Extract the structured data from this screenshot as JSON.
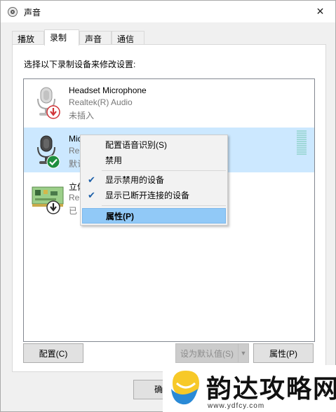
{
  "window": {
    "title": "声音",
    "close_symbol": "✕"
  },
  "tabs": [
    {
      "label": "播放"
    },
    {
      "label": "录制"
    },
    {
      "label": "声音"
    },
    {
      "label": "通信"
    }
  ],
  "panel": {
    "instruction": "选择以下录制设备来修改设置:"
  },
  "devices": [
    {
      "name": "Headset Microphone",
      "subtitle": "Realtek(R) Audio",
      "status": "未插入",
      "icon": "headset-microphone-icon",
      "badge": "red-down-arrow-badge"
    },
    {
      "name": "Microphone",
      "subtitle": "Re",
      "status": "默认",
      "icon": "microphone-icon",
      "badge": "green-check-badge",
      "selected": true
    },
    {
      "name": "立体声混音",
      "subtitle": "Re",
      "status": "已",
      "icon": "sound-card-icon",
      "badge": "black-down-arrow-badge"
    }
  ],
  "level_meter_segments": 12,
  "context_menu": {
    "items": [
      {
        "label": "配置语音识别(S)",
        "checked": false
      },
      {
        "label": "禁用",
        "checked": false
      },
      {
        "label": "显示禁用的设备",
        "checked": true
      },
      {
        "label": "显示已断开连接的设备",
        "checked": true
      },
      {
        "label": "属性(P)",
        "checked": false,
        "highlighted": true
      }
    ],
    "check_symbol": "✔"
  },
  "buttons": {
    "configure": "配置(C)",
    "set_default": "设为默认值(S)",
    "properties": "属性(P)",
    "ok_partial": "确"
  },
  "watermark": {
    "text": "韵达攻略网",
    "url": "www.ydfcy.com"
  },
  "colors": {
    "selection": "#cce8ff",
    "menu_highlight": "#91c9f7",
    "check_green": "#1e8e3e",
    "badge_red": "#d13438"
  }
}
